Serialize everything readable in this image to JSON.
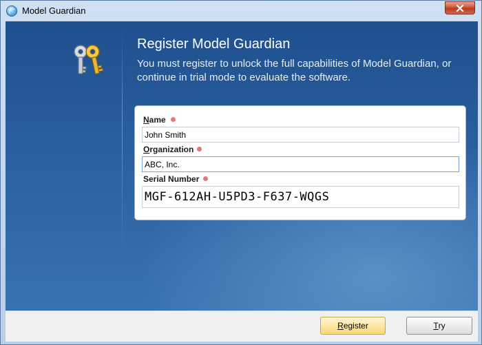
{
  "window": {
    "title": "Model Guardian",
    "close_icon": "close-icon"
  },
  "header": {
    "heading": "Register Model Guardian",
    "description": "You must register to unlock the full capabilities of Model Guardian, or continue in trial mode to evaluate the software.",
    "illustration": "keys-icon"
  },
  "form": {
    "name": {
      "label_mnemonic": "N",
      "label_rest": "ame",
      "value": "John Smith",
      "required": true
    },
    "organization": {
      "label_mnemonic": "O",
      "label_rest": "rganization",
      "value": "ABC, Inc.",
      "required": true
    },
    "serial": {
      "label": "Serial Number",
      "value": "MGF-612AH-U5PD3-F637-WQGS",
      "required": true
    }
  },
  "buttons": {
    "register_mnemonic": "R",
    "register_rest": "egister",
    "try_mnemonic": "T",
    "try_rest": "ry"
  },
  "colors": {
    "panel_gradient_top": "#1f4f8f",
    "panel_gradient_bottom": "#3a72b0",
    "required_indicator": "#e07a7a",
    "default_button": "#fde7a4"
  }
}
